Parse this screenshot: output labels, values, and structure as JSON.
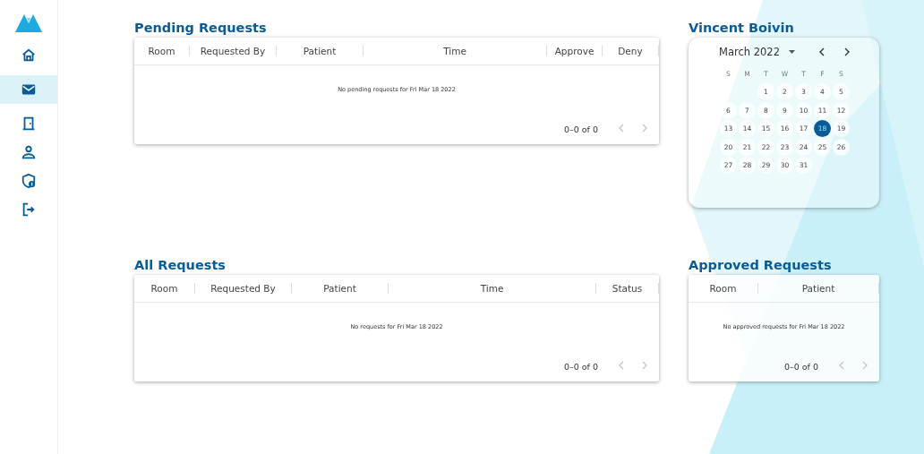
{
  "sidebar": {
    "items": [
      {
        "kind": "home",
        "selected": false
      },
      {
        "kind": "mail",
        "selected": true
      },
      {
        "kind": "door",
        "selected": false
      },
      {
        "kind": "person",
        "selected": false
      },
      {
        "kind": "shield",
        "selected": false
      },
      {
        "kind": "logout",
        "selected": false
      }
    ]
  },
  "pending_requests": {
    "title": "Pending Requests",
    "columns": [
      "Room",
      "Requested By",
      "Patient",
      "Time",
      "Approve",
      "Deny"
    ],
    "empty_message": "No pending requests for Fri Mar 18 2022",
    "pagination": {
      "range": "0–0 of 0",
      "prev_disabled": true,
      "next_disabled": true
    }
  },
  "all_requests": {
    "title": "All Requests",
    "columns": [
      "Room",
      "Requested By",
      "Patient",
      "Time",
      "Status"
    ],
    "empty_message": "No requests for Fri Mar 18 2022",
    "pagination": {
      "range": "0–0 of 0",
      "prev_disabled": true,
      "next_disabled": true
    }
  },
  "user": {
    "name": "Vincent Boivin"
  },
  "calendar": {
    "month": "March 2022",
    "weekdays": [
      "S",
      "M",
      "T",
      "W",
      "T",
      "F",
      "S"
    ],
    "days": [
      {
        "kind": "blank"
      },
      {
        "kind": "blank"
      },
      {
        "label": "1",
        "selected": false
      },
      {
        "label": "2",
        "selected": false
      },
      {
        "label": "3",
        "selected": false
      },
      {
        "label": "4",
        "selected": false
      },
      {
        "label": "5",
        "selected": false
      },
      {
        "label": "6",
        "selected": false
      },
      {
        "label": "7",
        "selected": false
      },
      {
        "label": "8",
        "selected": false
      },
      {
        "label": "9",
        "selected": false
      },
      {
        "label": "10",
        "selected": false
      },
      {
        "label": "11",
        "selected": false
      },
      {
        "label": "12",
        "selected": false
      },
      {
        "label": "13",
        "selected": false
      },
      {
        "label": "14",
        "selected": false
      },
      {
        "label": "15",
        "selected": false
      },
      {
        "label": "16",
        "selected": false
      },
      {
        "label": "17",
        "selected": false
      },
      {
        "label": "18",
        "selected": true
      },
      {
        "label": "19",
        "selected": false
      },
      {
        "label": "20",
        "selected": false
      },
      {
        "label": "21",
        "selected": false
      },
      {
        "label": "22",
        "selected": false
      },
      {
        "label": "23",
        "selected": false
      },
      {
        "label": "24",
        "selected": false
      },
      {
        "label": "25",
        "selected": false
      },
      {
        "label": "26",
        "selected": false
      },
      {
        "label": "27",
        "selected": false
      },
      {
        "label": "28",
        "selected": false
      },
      {
        "label": "29",
        "selected": false
      },
      {
        "label": "30",
        "selected": false
      },
      {
        "label": "31",
        "selected": false
      }
    ]
  },
  "approved_requests": {
    "title": "Approved Requests",
    "columns": [
      "Room",
      "Patient"
    ],
    "empty_message": "No approved requests for Fri Mar 18 2022",
    "pagination": {
      "range": "0–0 of 0",
      "prev_disabled": true,
      "next_disabled": true
    }
  }
}
